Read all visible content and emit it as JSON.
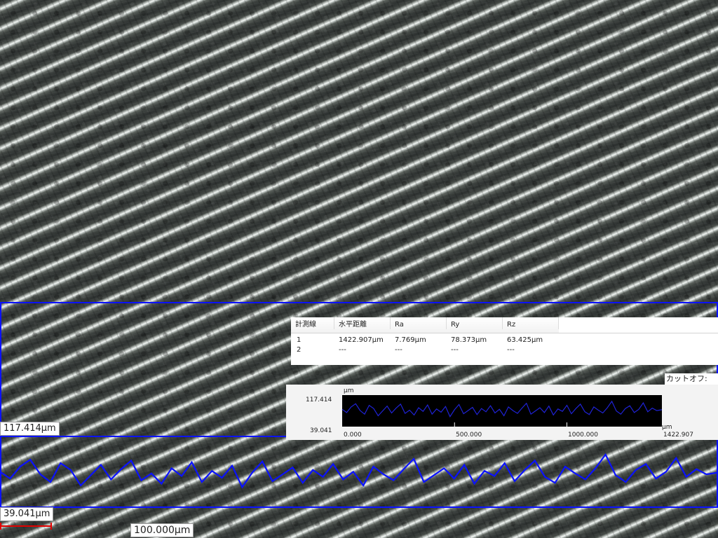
{
  "overlay": {
    "max_label": "117.414µm",
    "min_label": "39.041µm",
    "scale_label": "100.000µm",
    "frame_color": "#0b12ff",
    "scale_bar_color": "#e00000"
  },
  "results": {
    "headers": [
      "計測線",
      "水平距離",
      "Ra",
      "Ry",
      "Rz"
    ],
    "rows": [
      [
        "1",
        "1422.907µm",
        "7.769µm",
        "78.373µm",
        "63.425µm"
      ],
      [
        "2",
        "---",
        "---",
        "---",
        "---"
      ]
    ]
  },
  "cutoff_label": "カットオフ: 無し",
  "chart_data": {
    "type": "line",
    "unit_top": "µm",
    "unit_bottom": "µm",
    "y_tick_labels": [
      "117.414",
      "39.041"
    ],
    "ylim": [
      39.041,
      117.414
    ],
    "x_tick_labels": [
      "0.000",
      "500.000",
      "1000.000",
      "1422.907"
    ],
    "xlim": [
      0,
      1422.907
    ],
    "series": [
      {
        "color": "#1f22d6",
        "x": [
          0,
          20,
          40,
          60,
          80,
          100,
          120,
          140,
          160,
          180,
          200,
          220,
          240,
          260,
          280,
          300,
          320,
          340,
          360,
          380,
          400,
          420,
          440,
          460,
          480,
          500,
          520,
          540,
          560,
          580,
          600,
          620,
          640,
          660,
          680,
          700,
          720,
          740,
          760,
          780,
          800,
          820,
          840,
          860,
          880,
          900,
          920,
          940,
          960,
          980,
          1000,
          1020,
          1040,
          1060,
          1080,
          1100,
          1120,
          1140,
          1160,
          1180,
          1200,
          1220,
          1240,
          1260,
          1280,
          1300,
          1320,
          1340,
          1360,
          1380,
          1400,
          1422.907
        ],
        "y": [
          82,
          74,
          88,
          96,
          79,
          70,
          92,
          84,
          66,
          78,
          90,
          73,
          85,
          95,
          72,
          80,
          68,
          86,
          77,
          93,
          70,
          83,
          75,
          89,
          64,
          81,
          94,
          71,
          79,
          87,
          69,
          84,
          76,
          91,
          73,
          82,
          66,
          88,
          79,
          72,
          85,
          97,
          70,
          78,
          86,
          74,
          90,
          68,
          83,
          77,
          92,
          71,
          84,
          95,
          76,
          69,
          88,
          80,
          73,
          86,
          102,
          78,
          70,
          84,
          91,
          74,
          82,
          98,
          76,
          85,
          79,
          81
        ]
      }
    ]
  }
}
